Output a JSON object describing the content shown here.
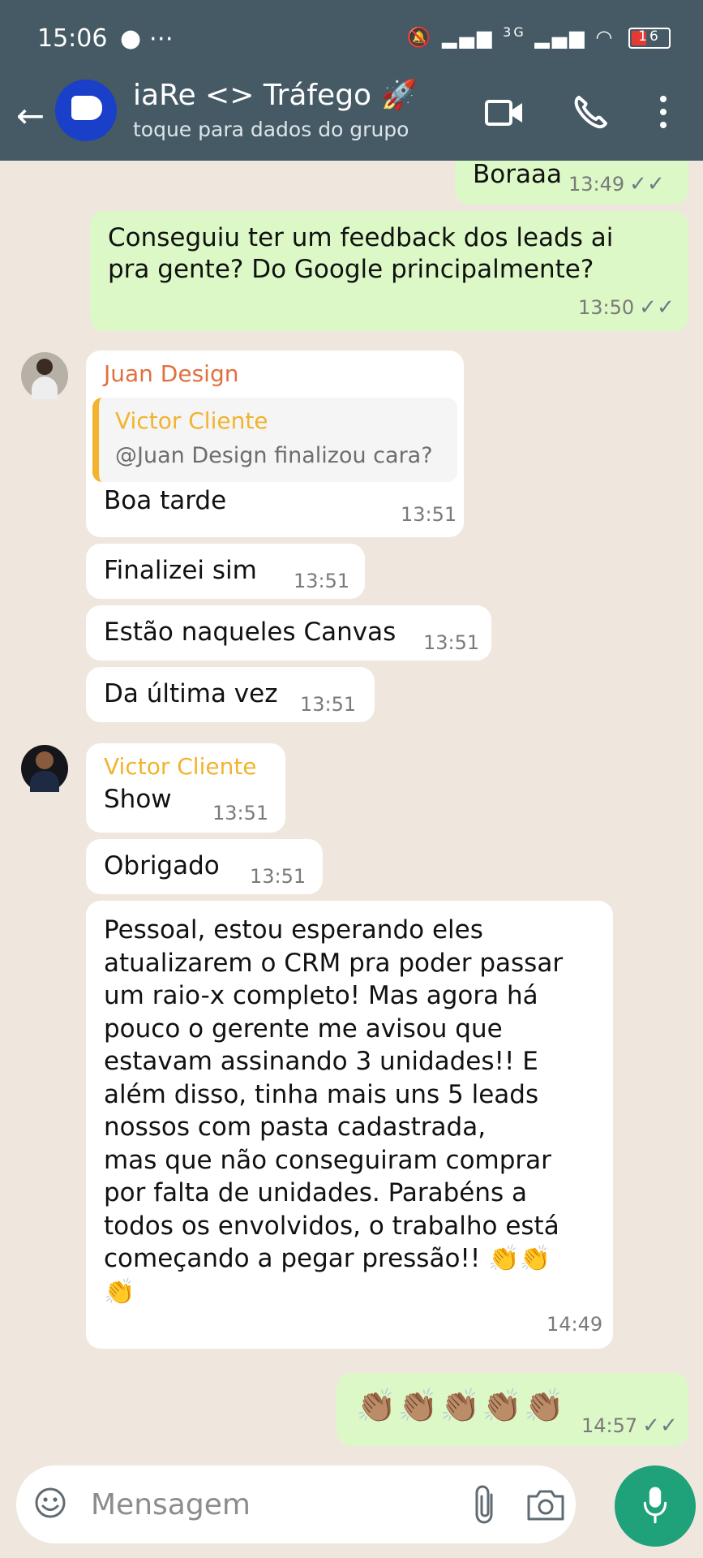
{
  "status_bar": {
    "time": "15:06",
    "notif": "⋯",
    "network": "3G",
    "battery": "16"
  },
  "header": {
    "title": "iaRe <> Tráfego 🚀",
    "subtitle": "toque para dados do grupo"
  },
  "messages": {
    "m1": {
      "text": "Boraaa",
      "time": "13:49"
    },
    "m2": {
      "line1": "Conseguiu ter um feedback dos leads ai",
      "line2": "pra gente? Do Google principalmente?",
      "time": "13:50"
    },
    "m3": {
      "sender": "Juan Design",
      "quote_sender": "Victor Cliente",
      "quote_text": "@Juan Design finalizou cara?",
      "text": "Boa tarde",
      "time": "13:51"
    },
    "m4": {
      "text": "Finalizei sim",
      "time": "13:51"
    },
    "m5": {
      "text": "Estão naqueles Canvas",
      "time": "13:51"
    },
    "m6": {
      "text": "Da última vez",
      "time": "13:51"
    },
    "m7": {
      "sender": "Victor Cliente",
      "text": "Show",
      "time": "13:51"
    },
    "m8": {
      "text": "Obrigado",
      "time": "13:51"
    },
    "m9": {
      "lines": [
        "Pessoal, estou esperando eles",
        "atualizarem o CRM pra poder passar",
        "um raio-x completo! Mas agora há",
        "pouco o gerente me avisou que",
        "estavam assinando 3 unidades!! E",
        "além disso, tinha mais uns 5 leads",
        "nossos com pasta cadastrada,",
        "mas que não conseguiram comprar",
        "por falta de unidades. Parabéns a",
        "todos os envolvidos, o trabalho está",
        "começando a pegar pressão!! 👏👏",
        "👏"
      ],
      "time": "14:49"
    },
    "m10": {
      "text": "👏🏽👏🏽👏🏽👏🏽👏🏽",
      "time": "14:57"
    }
  },
  "input": {
    "placeholder": "Mensagem"
  },
  "colors": {
    "header": "#455a64",
    "chat_bg": "#efe7de",
    "outgoing": "#dcf8c6",
    "incoming": "#ffffff",
    "accent": "#1fa17a",
    "juan": "#e07040",
    "victor": "#f2b32e"
  },
  "icons": [
    "back-arrow-icon",
    "video-call-icon",
    "phone-icon",
    "more-vert-icon",
    "emoji-icon",
    "attach-icon",
    "camera-icon",
    "mic-icon",
    "double-check-icon"
  ]
}
